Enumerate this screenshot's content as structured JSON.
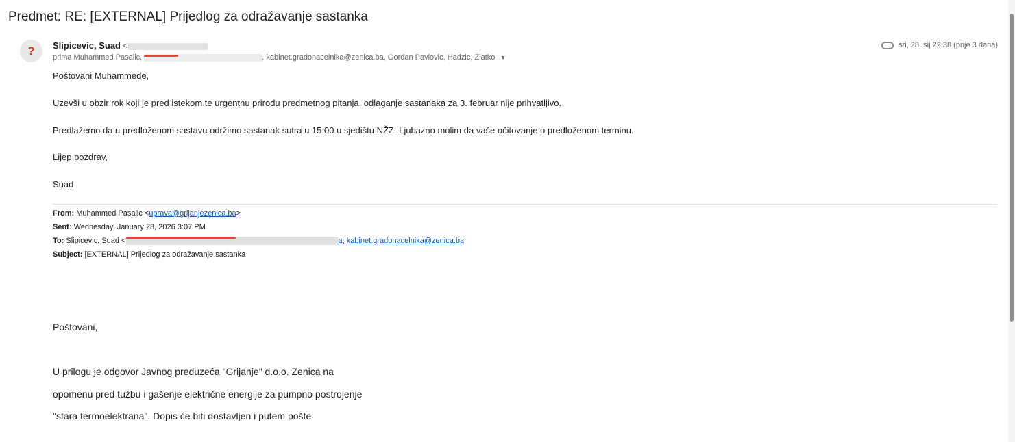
{
  "subject": "Predmet: RE: [EXTERNAL] Prijedlog za odražavanje sastanka",
  "avatar_glyph": "?",
  "sender": {
    "name": "Slipicevic, Suad",
    "angle": "<"
  },
  "recipients": {
    "prefix": "prima Muhammed Pasalic,",
    "suffix": ", kabinet.gradonacelnika@zenica.ba, Gordan Pavlovic, Hadzic, Zlatko"
  },
  "meta": {
    "date": "sri, 28. sij 22:38 (prije 3 dana)"
  },
  "body": {
    "greeting": "Poštovani Muhammede,",
    "p1": "Uzevši u obzir rok koji je pred istekom te urgentnu prirodu predmetnog pitanja, odlaganje sastanaka za 3. februar nije prihvatljivo.",
    "p2": "Predlažemo da u predloženom sastavu održimo sastanak sutra u 15:00 u sjedištu NŽZ. Ljubazno molim da vaše očitovanje o predloženom terminu.",
    "closing": "Lijep pozdrav,",
    "signature": "Suad"
  },
  "quoted_header": {
    "from_label": "From:",
    "from_name": "Muhammed Pasalic <",
    "from_email": "uprava@grijanjezenica.ba",
    "from_end": ">",
    "sent_label": "Sent:",
    "sent_value": "Wednesday, January 28, 2026 3:07 PM",
    "to_label": "To:",
    "to_name": "Slipicevic, Suad <",
    "to_redacted_end": "a",
    "to_sep": "; ",
    "to_email2": "kabinet.gradonacelnika@zenica.ba",
    "subject_label": "Subject:",
    "subject_value": "[EXTERNAL] Prijedlog za odražavanje sastanka"
  },
  "quoted_body": {
    "greeting": "Poštovani,",
    "line1": "U prilogu je odgovor Javnog preduzeća \"Grijanje\" d.o.o. Zenica na",
    "line2": "opomenu pred tužbu i gašenje električne energije za pumpno postrojenje",
    "line3": "\"stara termoelektrana\". Dopis će biti dostavljen i putem pošte"
  }
}
